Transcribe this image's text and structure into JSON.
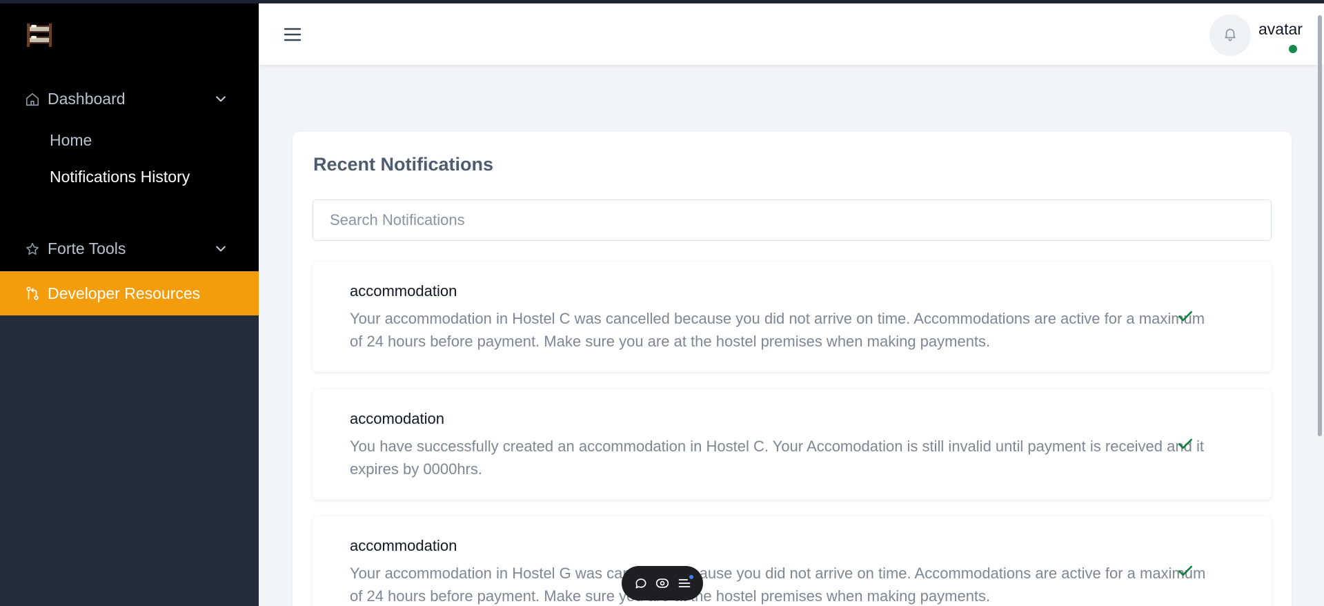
{
  "sidebar": {
    "logo": "bunk-bed-logo",
    "dashboard": {
      "label": "Dashboard",
      "icon": "home-icon",
      "expanded": true
    },
    "submenu": [
      {
        "label": "Home"
      },
      {
        "label": "Notifications History"
      }
    ],
    "forte_tools": {
      "label": "Forte Tools",
      "icon": "star-icon"
    },
    "developer_resources": {
      "label": "Developer Resources",
      "icon": "git-compare-icon",
      "active_color": "#f49d0c"
    }
  },
  "header": {
    "menu_icon": "hamburger-icon",
    "bell_icon": "bell-icon",
    "user_name": "avatar",
    "status_color": "#148a4c"
  },
  "main": {
    "title": "Recent Notifications",
    "search": {
      "placeholder": "Search Notifications",
      "value": ""
    },
    "notifications": [
      {
        "title": "accommodation",
        "body": "Your accommodation in Hostel C was cancelled because you did not arrive on time. Accommodations are active for a maximum of 24 hours before payment. Make sure you are at the hostel premises when making payments.",
        "read": true
      },
      {
        "title": "accomodation",
        "body": "You have successfully created an accommodation in Hostel C. Your Accomodation is still invalid until payment is received and it expires by 0000hrs.",
        "read": true
      },
      {
        "title": "accommodation",
        "body": "Your accommodation in Hostel G was cancelled because you did not arrive on time. Accommodations are active for a maximum of 24 hours before payment. Make sure you are at the hostel premises when making payments.",
        "read": true
      }
    ]
  },
  "floating_toolbar": {
    "icons": [
      "comment-icon",
      "eye-icon",
      "list-icon"
    ]
  },
  "colors": {
    "sidebar_bg": "#222c38",
    "accent": "#f49d0c",
    "check": "#15803d"
  }
}
